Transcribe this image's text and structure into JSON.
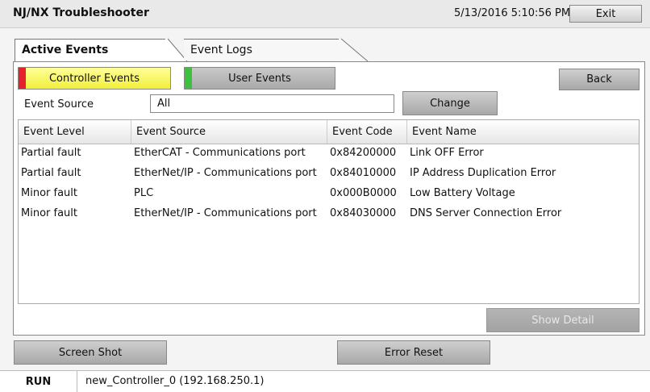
{
  "titlebar": {
    "title": "NJ/NX Troubleshooter",
    "datetime": "5/13/2016 5:10:56 PM",
    "exit_label": "Exit"
  },
  "tabs": [
    {
      "label": "Active Events",
      "selected": true
    },
    {
      "label": "Event Logs",
      "selected": false
    }
  ],
  "filters": {
    "controller_events_label": "Controller Events",
    "user_events_label": "User Events",
    "back_label": "Back",
    "event_source_label": "Event Source",
    "event_source_value": "All",
    "change_label": "Change"
  },
  "table": {
    "columns": [
      "Event Level",
      "Event Source",
      "Event Code",
      "Event Name"
    ],
    "rows": [
      [
        "Partial fault",
        "EtherCAT - Communications port",
        "0x84200000",
        "Link OFF Error"
      ],
      [
        "Partial fault",
        "EtherNet/IP - Communications port",
        "0x84010000",
        "IP Address Duplication Error"
      ],
      [
        "Minor fault",
        "PLC",
        "0x000B0000",
        "Low Battery Voltage"
      ],
      [
        "Minor fault",
        "EtherNet/IP - Communications port",
        "0x84030000",
        "DNS Server Connection Error"
      ]
    ]
  },
  "actions": {
    "show_detail_label": "Show Detail",
    "screen_shot_label": "Screen Shot",
    "error_reset_label": "Error Reset"
  },
  "statusbar": {
    "mode": "RUN",
    "controller": "new_Controller_0 (192.168.250.1)"
  },
  "colors": {
    "controller_indicator": "#e5212c",
    "user_indicator": "#3fbf3f",
    "controller_button": "#f2ef3b"
  }
}
